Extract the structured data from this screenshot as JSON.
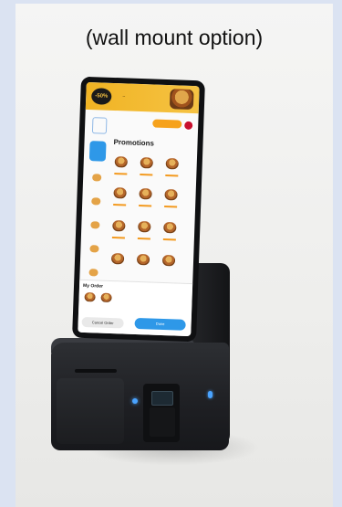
{
  "caption": "(wall mount option)",
  "screen": {
    "badge": "-50%",
    "section_title": "Promotions",
    "order_label": "My Order",
    "cancel_label": "Cancel Order",
    "done_label": "Done"
  },
  "colors": {
    "accent_blue": "#2e98e8",
    "banner_yellow": "#f6c343",
    "kiosk_body": "#1e1f23",
    "background": "#dbe3f2"
  }
}
